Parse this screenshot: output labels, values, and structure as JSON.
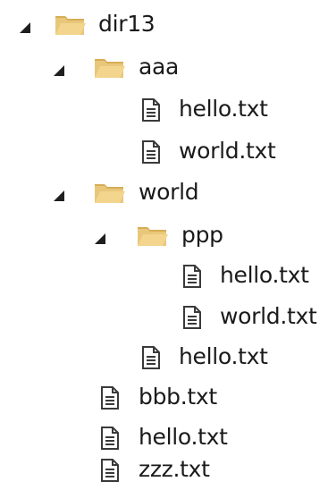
{
  "tree": {
    "root": {
      "name": "dir13",
      "icon": "folder-open-icon",
      "expanded": true,
      "children": {
        "aaa": {
          "name": "aaa",
          "icon": "folder-open-icon",
          "expanded": true,
          "files": [
            "hello.txt",
            "world.txt"
          ]
        },
        "world": {
          "name": "world",
          "icon": "folder-open-icon",
          "expanded": true,
          "children": {
            "ppp": {
              "name": "ppp",
              "icon": "folder-open-icon",
              "expanded": true,
              "files": [
                "hello.txt",
                "world.txt"
              ]
            }
          },
          "files": [
            "hello.txt"
          ]
        }
      },
      "files": [
        "bbb.txt",
        "hello.txt",
        "zzz.txt"
      ]
    }
  },
  "colors": {
    "folder": "#e8c77a",
    "folder_dark": "#d7ad55",
    "text": "#1a1a1a",
    "file_icon_stroke": "#3a3a3a"
  }
}
